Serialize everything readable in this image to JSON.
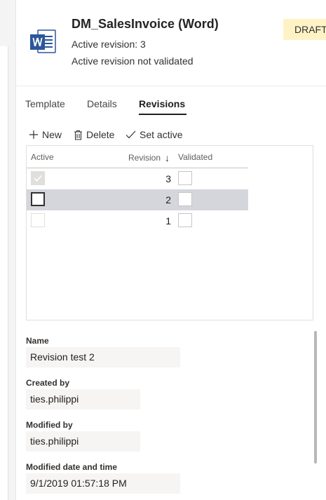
{
  "header": {
    "title": "DM_SalesInvoice (Word)",
    "active_revision": "Active revision: 3",
    "validation_status": "Active revision not validated",
    "badge": "DRAFT",
    "icon": "word-document-icon"
  },
  "tabs": [
    {
      "label": "Template",
      "selected": false
    },
    {
      "label": "Details",
      "selected": false
    },
    {
      "label": "Revisions",
      "selected": true
    }
  ],
  "toolbar": {
    "new_label": "New",
    "delete_label": "Delete",
    "set_active_label": "Set active"
  },
  "grid": {
    "columns": {
      "active": "Active",
      "revision": "Revision",
      "validated": "Validated",
      "sort_indicator": "↓"
    },
    "rows": [
      {
        "revision": "3",
        "active": true,
        "validated": false,
        "selected": false
      },
      {
        "revision": "2",
        "active": false,
        "validated": false,
        "selected": true
      },
      {
        "revision": "1",
        "active": false,
        "validated": false,
        "selected": false
      }
    ]
  },
  "fields": {
    "name_label": "Name",
    "name_value": "Revision test 2",
    "created_by_label": "Created by",
    "created_by_value": "ties.philippi",
    "modified_by_label": "Modified by",
    "modified_by_value": "ties.philippi",
    "modified_date_label": "Modified date and time",
    "modified_date_value": "9/1/2019 01:57:18 PM"
  },
  "colors": {
    "word_blue": "#2b579a",
    "badge_bg": "#fff3c6",
    "selected_row": "#d4d6dc"
  }
}
